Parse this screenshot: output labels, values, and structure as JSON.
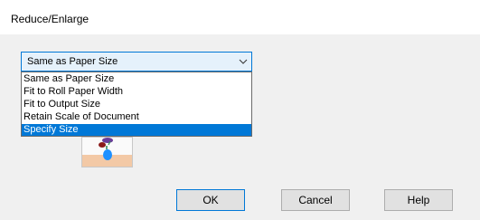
{
  "window": {
    "title": "Reduce/Enlarge"
  },
  "reduce_enlarge": {
    "selected_value": "Same as Paper Size",
    "options": [
      "Same as Paper Size",
      "Fit to Roll Paper Width",
      "Fit to Output Size",
      "Retain Scale of Document",
      "Specify Size"
    ],
    "highlighted_option": "Specify Size"
  },
  "preview": {
    "icon": "image-preview-icon"
  },
  "buttons": {
    "ok": "OK",
    "cancel": "Cancel",
    "help": "Help"
  },
  "colors": {
    "accent": "#0078d7",
    "dialog_bg": "#f0f0f0",
    "selection_bg": "#0078d7",
    "combo_bg": "#e5f1fb"
  }
}
